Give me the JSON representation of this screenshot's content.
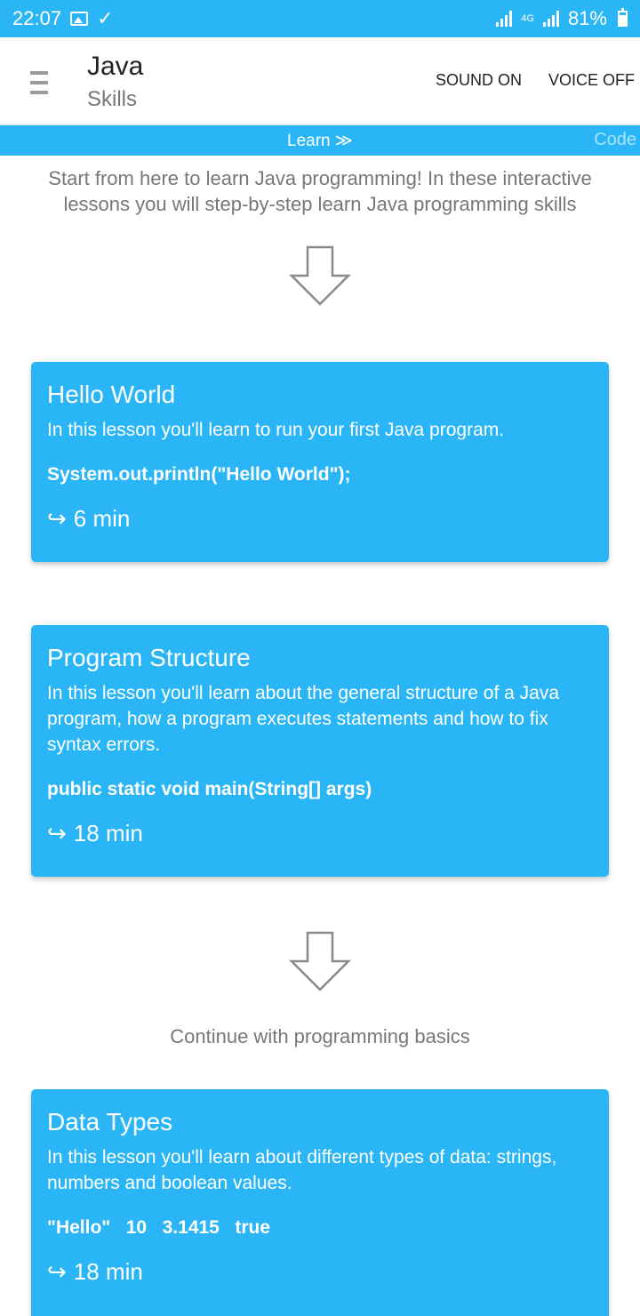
{
  "status_bar": {
    "time": "22:07",
    "network": "4G",
    "battery": "81%"
  },
  "app_bar": {
    "title": "Java",
    "subtitle": "Skills",
    "sound": "SOUND ON",
    "voice": "VOICE OFF"
  },
  "tabs": {
    "learn": "Learn ≫",
    "code": "Code"
  },
  "intro": "Start from here to learn Java programming! In these interactive lessons you will step-by-step learn Java programming skills",
  "continue_text": "Continue with programming basics",
  "lessons": [
    {
      "title": "Hello World",
      "description": "In this lesson you'll learn to run your first Java program.",
      "code": "System.out.println(\"Hello World\");",
      "duration": "6 min"
    },
    {
      "title": "Program Structure",
      "description": "In this lesson you'll learn about the general structure of a Java program, how a program executes statements and how to fix syntax errors.",
      "code": "public static void main(String[] args)",
      "duration": "18 min"
    },
    {
      "title": "Data Types",
      "description": "In this lesson you'll learn about different types of data: strings, numbers and boolean values.",
      "code": "\"Hello\"   10   3.1415   true",
      "duration": "18 min"
    }
  ],
  "icons": {
    "time_icon": "↪",
    "accent": "#2ab6f6"
  }
}
